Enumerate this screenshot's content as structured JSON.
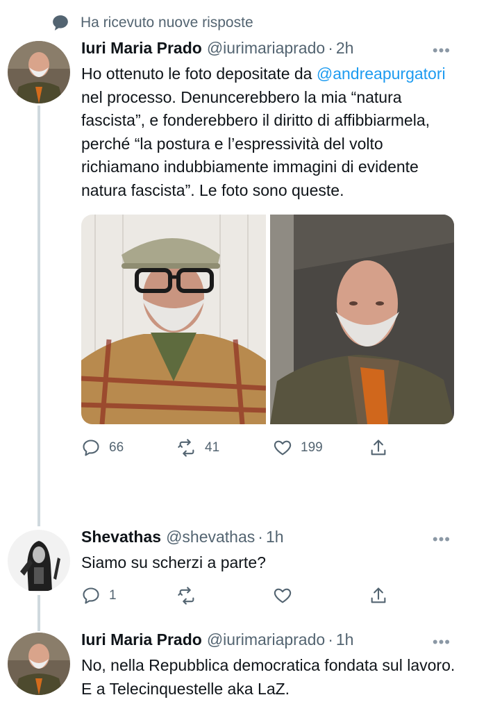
{
  "context": {
    "label": "Ha ricevuto nuove risposte",
    "icon": "reply-bubble-icon"
  },
  "tweets": [
    {
      "name": "Iuri Maria Prado",
      "handle": "@iurimariaprado",
      "time": "2h",
      "text_before": "Ho ottenuto le foto depositate da ",
      "mention": "@andreapurgatori",
      "text_after": " nel processo. Denuncerebbero la mia “natura fascista”, e fonderebbero il diritto di affibbiarmela, perché “la postura e l’espressività del volto richiamano indubbiamente immagini di evidente natura fascista”. Le foto sono queste.",
      "replies": "66",
      "retweets": "41",
      "likes": "199"
    },
    {
      "name": "Shevathas",
      "handle": "@shevathas",
      "time": "1h",
      "text": "Siamo su scherzi a parte?",
      "replies": "1",
      "retweets": "",
      "likes": ""
    },
    {
      "name": "Iuri Maria Prado",
      "handle": "@iurimariaprado",
      "time": "1h",
      "text": "No, nella Repubblica democratica fondata sul lavoro. E a Telecinquestelle aka LaZ."
    }
  ],
  "more_label": "•••",
  "separator": "·",
  "colors": {
    "link": "#1d9bf0",
    "muted": "#536471",
    "thread": "#cfd9de"
  }
}
